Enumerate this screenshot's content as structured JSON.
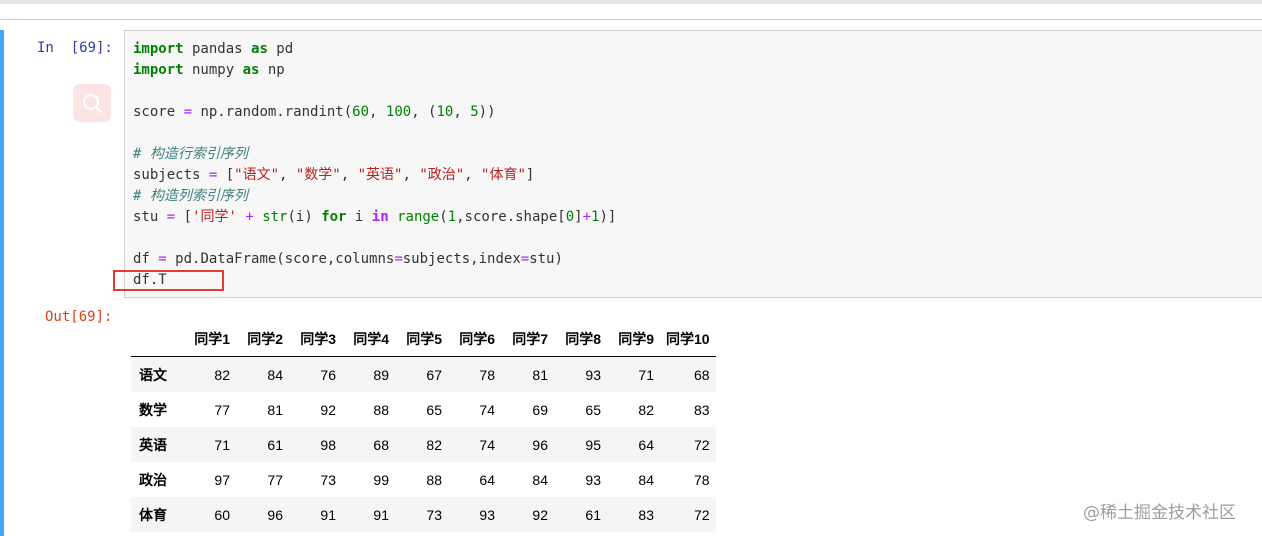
{
  "cell": {
    "in_prompt": "In  [69]:",
    "out_prompt": "Out[69]:",
    "search_icon": "search-icon"
  },
  "code": {
    "l1_kw": "import",
    "l1_rest": " pandas ",
    "l1_as": "as",
    "l1_alias": " pd",
    "l2_kw": "import",
    "l2_rest": " numpy ",
    "l2_as": "as",
    "l2_alias": " np",
    "l4_a": "score ",
    "l4_eq": "=",
    "l4_b": " np.random.randint(",
    "l4_n1": "60",
    "l4_c": ", ",
    "l4_n2": "100",
    "l4_d": ", (",
    "l4_n3": "10",
    "l4_e": ", ",
    "l4_n4": "5",
    "l4_f": "))",
    "l6_comment": "# 构造行索引序列",
    "l7_a": "subjects ",
    "l7_eq": "=",
    "l7_b": " [",
    "l7_s1": "\"语文\"",
    "l7_s2": "\"数学\"",
    "l7_s3": "\"英语\"",
    "l7_s4": "\"政治\"",
    "l7_s5": "\"体育\"",
    "l7_sep": ", ",
    "l7_end": "]",
    "l8_comment": "# 构造列索引序列",
    "l9_a": "stu ",
    "l9_eq": "=",
    "l9_b": " [",
    "l9_s": "'同学'",
    "l9_c": " ",
    "l9_plus": "+",
    "l9_d": " ",
    "l9_str": "str",
    "l9_e": "(i) ",
    "l9_for": "for",
    "l9_f": " i ",
    "l9_in": "in",
    "l9_g": " ",
    "l9_range": "range",
    "l9_h": "(",
    "l9_n1": "1",
    "l9_i": ",score.shape[",
    "l9_n0": "0",
    "l9_j": "]",
    "l9_plus2": "+",
    "l9_n2": "1",
    "l9_k": ")]",
    "l11_a": "df ",
    "l11_eq": "=",
    "l11_b": " pd.DataFrame(score,columns",
    "l11_eq2": "=",
    "l11_c": "subjects,index",
    "l11_eq3": "=",
    "l11_d": "stu)",
    "l12": "df.T"
  },
  "table": {
    "columns": [
      "同学1",
      "同学2",
      "同学3",
      "同学4",
      "同学5",
      "同学6",
      "同学7",
      "同学8",
      "同学9",
      "同学10"
    ],
    "rows": [
      {
        "index": "语文",
        "values": [
          "82",
          "84",
          "76",
          "89",
          "67",
          "78",
          "81",
          "93",
          "71",
          "68"
        ]
      },
      {
        "index": "数学",
        "values": [
          "77",
          "81",
          "92",
          "88",
          "65",
          "74",
          "69",
          "65",
          "82",
          "83"
        ]
      },
      {
        "index": "英语",
        "values": [
          "71",
          "61",
          "98",
          "68",
          "82",
          "74",
          "96",
          "95",
          "64",
          "72"
        ]
      },
      {
        "index": "政治",
        "values": [
          "97",
          "77",
          "73",
          "99",
          "88",
          "64",
          "84",
          "93",
          "84",
          "78"
        ]
      },
      {
        "index": "体育",
        "values": [
          "60",
          "96",
          "91",
          "91",
          "73",
          "93",
          "92",
          "61",
          "83",
          "72"
        ]
      }
    ]
  },
  "watermark": "@稀土掘金技术社区",
  "colors": {
    "cell_bar": "#42a5f5",
    "in_prompt": "#303f9f",
    "out_prompt": "#d84315",
    "highlight_box": "#e53935"
  }
}
